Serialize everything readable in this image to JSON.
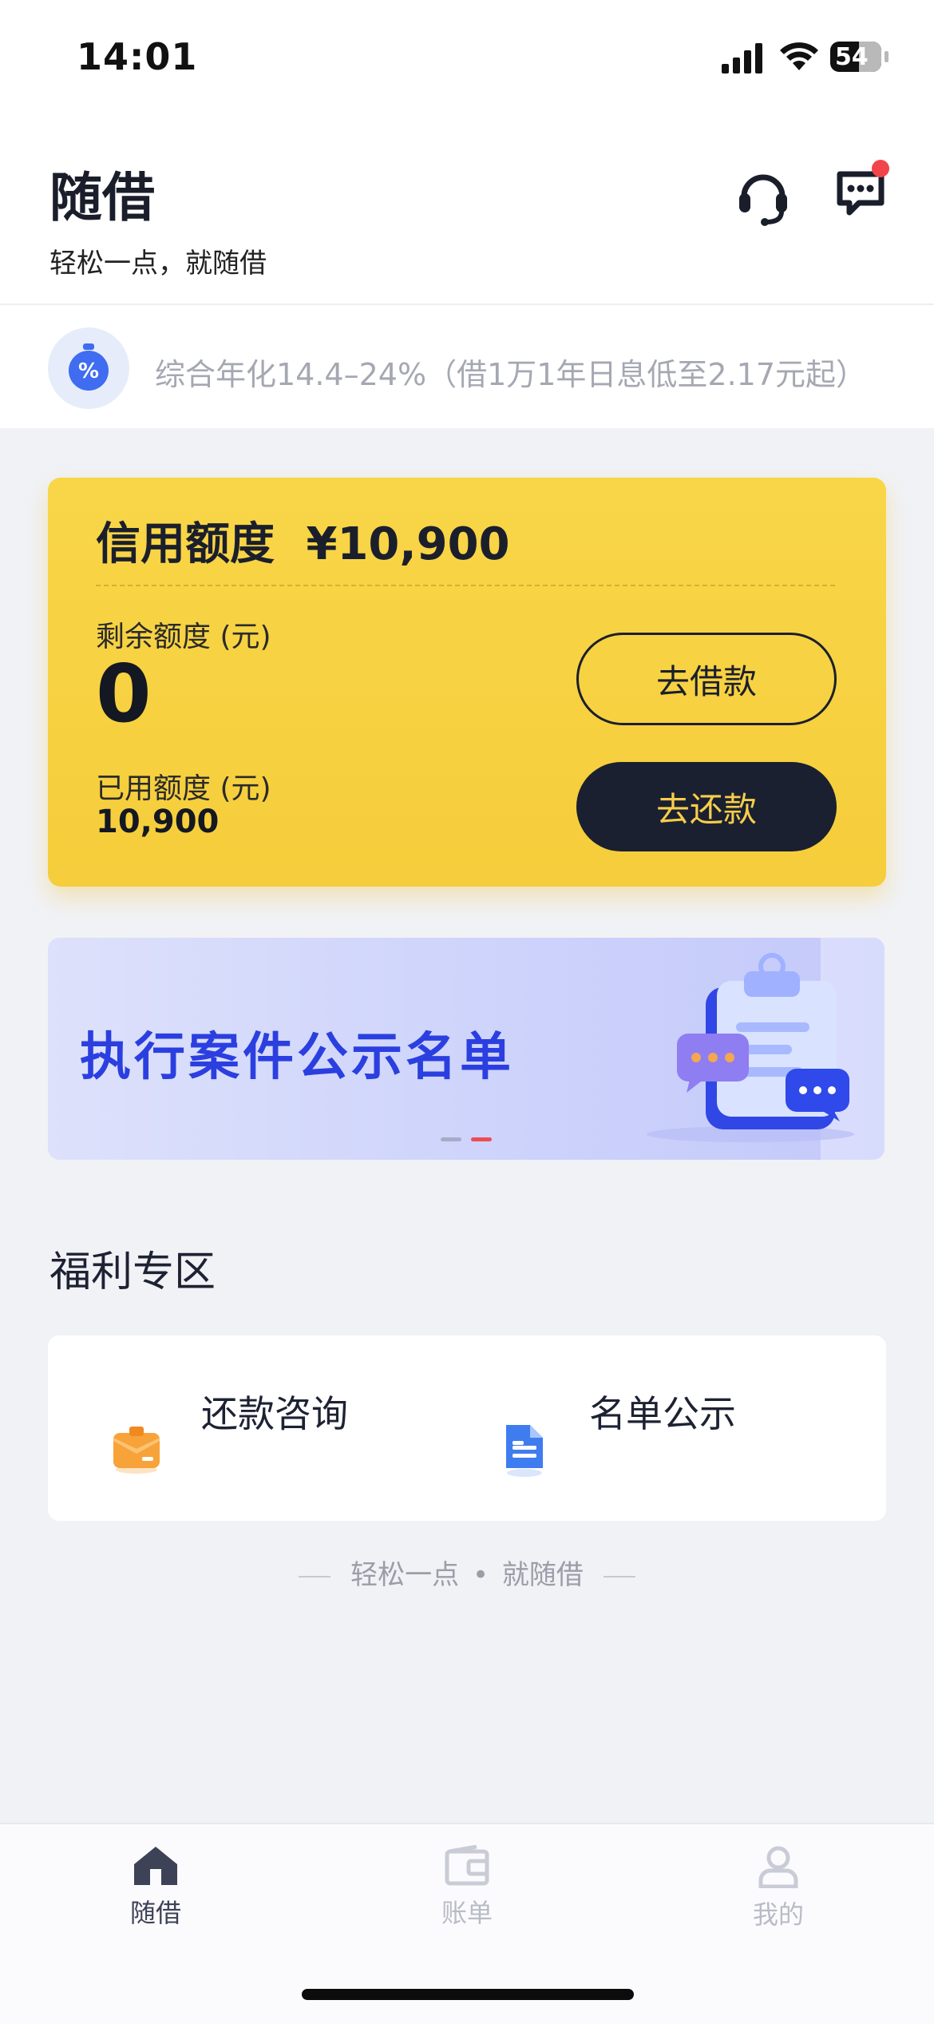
{
  "status_bar": {
    "time": "14:01",
    "battery": "54"
  },
  "header": {
    "title": "随借",
    "subtitle": "轻松一点，就随借"
  },
  "notice": {
    "text": "综合年化14.4–24%（借1万1年日息低至2.17元起）"
  },
  "credit_card": {
    "title": "信用额度",
    "total_amount": "¥10,900",
    "remaining_label": "剩余额度 (元)",
    "remaining_value": "0",
    "used_label": "已用额度 (元)",
    "used_value": "10,900",
    "borrow_button": "去借款",
    "repay_button": "去还款"
  },
  "banner": {
    "text": "执行案件公示名单"
  },
  "welfare": {
    "section_title": "福利专区",
    "items": [
      {
        "label": "还款咨询",
        "icon": "consultant-icon"
      },
      {
        "label": "名单公示",
        "icon": "document-icon"
      }
    ]
  },
  "footer": {
    "slogan_left": "轻松一点",
    "slogan_right": "就随借"
  },
  "tabbar": {
    "items": [
      {
        "label": "随借",
        "icon": "home-icon",
        "active": true
      },
      {
        "label": "账单",
        "icon": "wallet-icon",
        "active": false
      },
      {
        "label": "我的",
        "icon": "profile-icon",
        "active": false
      }
    ]
  },
  "colors": {
    "accent_yellow": "#f7d047",
    "dark_navy": "#1a2030",
    "banner_blue": "#2b3fe0",
    "notification_red": "#f2454a"
  }
}
